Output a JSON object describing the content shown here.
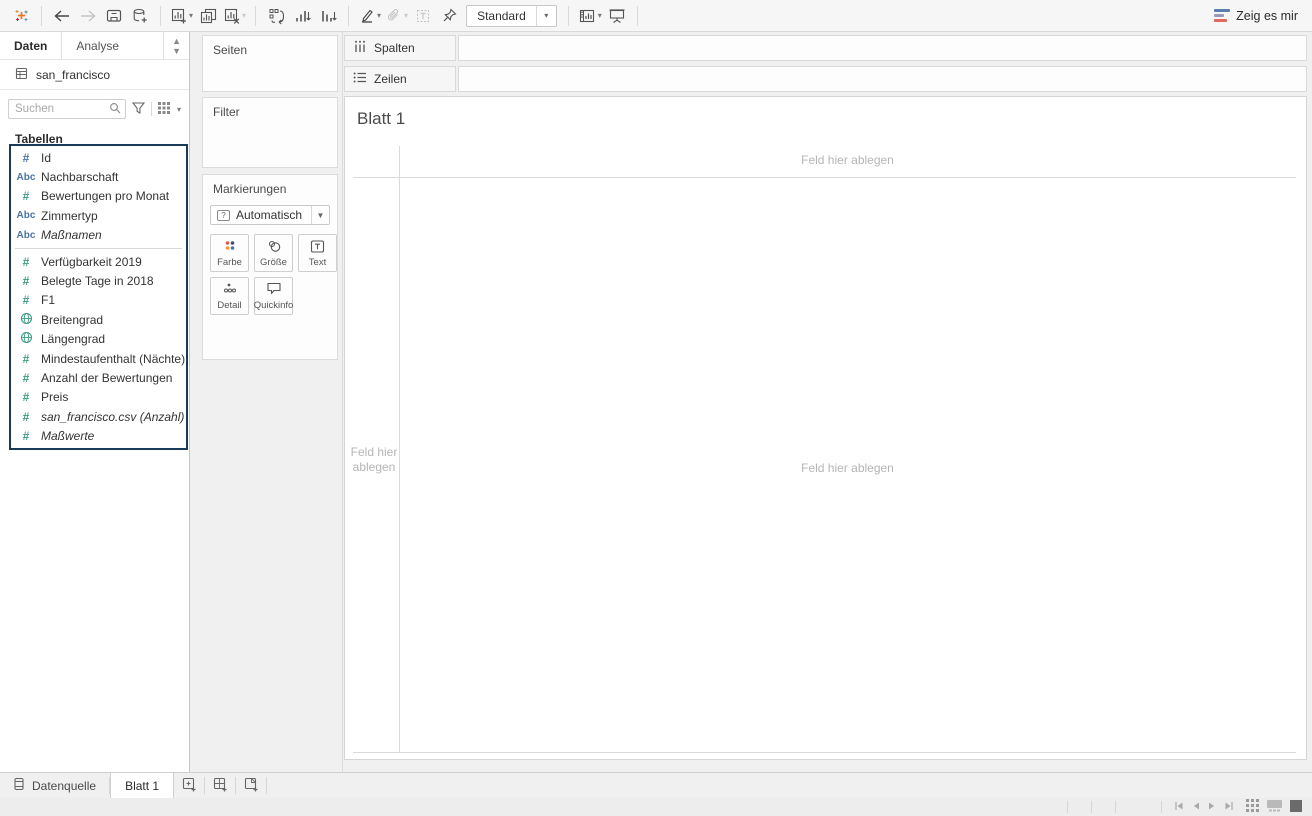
{
  "toolbar": {
    "fit_selector_value": "Standard",
    "show_me_label": "Zeig es mir",
    "icons": [
      "tableau-logo",
      "undo-arrow",
      "redo-arrow",
      "save",
      "add-datasource",
      "new-worksheet",
      "duplicate-sheet",
      "clear-sheet",
      "swap-rows-columns",
      "sort-ascending",
      "sort-descending",
      "highlight",
      "group-members",
      "show-mark-labels",
      "fix-pin",
      "fit-selector",
      "show-hide-cards",
      "presentation-mode",
      "show-me-bars"
    ]
  },
  "sidebar": {
    "tabs": [
      {
        "label": "Daten",
        "active": true
      },
      {
        "label": "Analyse",
        "active": false
      }
    ],
    "datasource_name": "san_francisco",
    "search_placeholder": "Suchen",
    "section_title": "Tabellen",
    "fields": [
      {
        "name": "Id",
        "icon": "hash",
        "color": "blue",
        "italic": false
      },
      {
        "name": "Nachbarschaft",
        "icon": "abc",
        "color": "blue",
        "italic": false
      },
      {
        "name": "Bewertungen pro Monat",
        "icon": "hash",
        "color": "green",
        "italic": false
      },
      {
        "name": "Zimmertyp",
        "icon": "abc",
        "color": "blue",
        "italic": false
      },
      {
        "name": "Maßnamen",
        "icon": "abc",
        "color": "blue",
        "italic": true,
        "divider_after": true
      },
      {
        "name": "Verfügbarkeit 2019",
        "icon": "hash",
        "color": "green",
        "italic": false
      },
      {
        "name": "Belegte Tage in 2018",
        "icon": "hash",
        "color": "green",
        "italic": false
      },
      {
        "name": "F1",
        "icon": "hash",
        "color": "green",
        "italic": false
      },
      {
        "name": "Breitengrad",
        "icon": "globe",
        "color": "green",
        "italic": false
      },
      {
        "name": "Längengrad",
        "icon": "globe",
        "color": "green",
        "italic": false
      },
      {
        "name": "Mindestaufenthalt (Nächte)",
        "icon": "hash",
        "color": "green",
        "italic": false
      },
      {
        "name": "Anzahl der Bewertungen",
        "icon": "hash",
        "color": "green",
        "italic": false
      },
      {
        "name": "Preis",
        "icon": "hash",
        "color": "green",
        "italic": false
      },
      {
        "name": "san_francisco.csv (Anzahl)",
        "icon": "hash",
        "color": "green",
        "italic": true
      },
      {
        "name": "Maßwerte",
        "icon": "hash",
        "color": "green",
        "italic": true
      }
    ]
  },
  "cards": {
    "pages": {
      "title": "Seiten"
    },
    "filters": {
      "title": "Filter"
    },
    "marks": {
      "title": "Markierungen",
      "mark_type": "Automatisch",
      "buttons": [
        {
          "label": "Farbe",
          "icon": "color-icon"
        },
        {
          "label": "Größe",
          "icon": "size-icon"
        },
        {
          "label": "Text",
          "icon": "text-icon"
        },
        {
          "label": "Detail",
          "icon": "detail-icon"
        },
        {
          "label": "Quickinfo",
          "icon": "tooltip-icon"
        }
      ]
    }
  },
  "shelves": {
    "columns_label": "Spalten",
    "rows_label": "Zeilen"
  },
  "canvas": {
    "sheet_title": "Blatt 1",
    "drop_zone_top": "Feld hier ablegen",
    "drop_zone_center": "Feld hier ablegen",
    "drop_zone_left": "Feld hier ablegen"
  },
  "sheet_tabs": {
    "datasource_tab": "Datenquelle",
    "active_sheet_tab": "Blatt 1"
  },
  "colors": {
    "dimension_blue": "#4c74a4",
    "measure_green": "#3d9d83",
    "selection_border": "#1b3a57",
    "showme_blue": "#5a7fae",
    "showme_gray": "#9a9ab5",
    "showme_red": "#e0695f"
  }
}
